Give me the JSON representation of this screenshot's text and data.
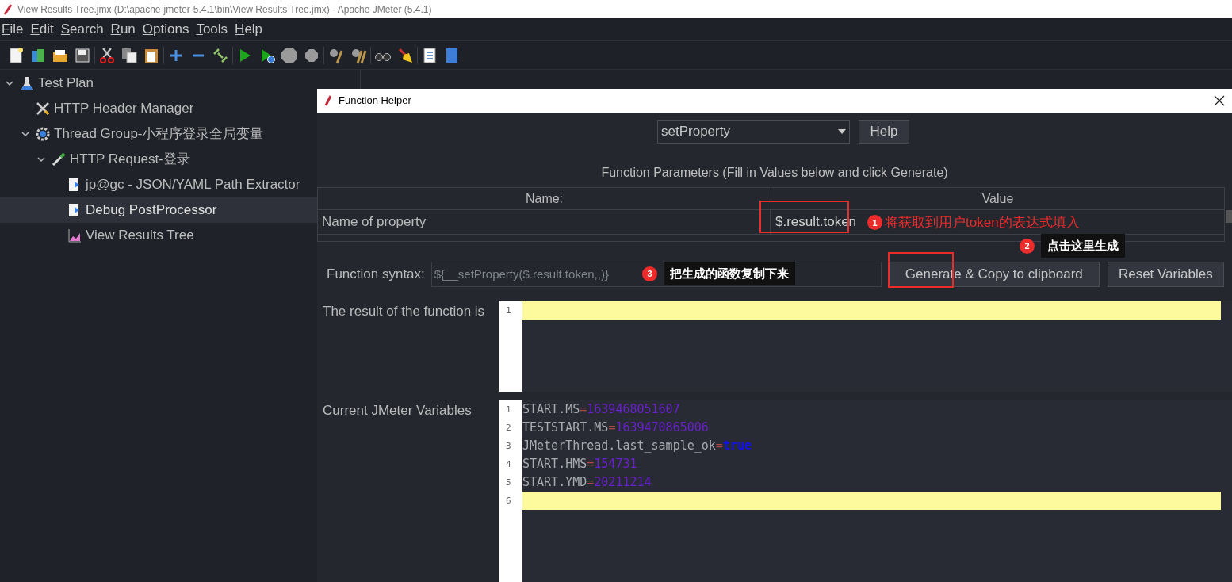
{
  "window": {
    "title": "View Results Tree.jmx (D:\\apache-jmeter-5.4.1\\bin\\View Results Tree.jmx) - Apache JMeter (5.4.1)"
  },
  "menu": [
    {
      "label": "File"
    },
    {
      "label": "Edit"
    },
    {
      "label": "Search"
    },
    {
      "label": "Run"
    },
    {
      "label": "Options"
    },
    {
      "label": "Tools"
    },
    {
      "label": "Help"
    }
  ],
  "tree": [
    {
      "label": "Test Plan",
      "kind": "plan",
      "expanded": true,
      "selected": false,
      "children": [
        {
          "label": "HTTP Header Manager",
          "kind": "config",
          "selected": false
        },
        {
          "label": "Thread Group-小程序登录全局变量",
          "kind": "threads",
          "expanded": true,
          "selected": false,
          "children": [
            {
              "label": "HTTP Request-登录",
              "kind": "sampler",
              "expanded": true,
              "selected": false,
              "children": [
                {
                  "label": "jp@gc - JSON/YAML Path Extractor",
                  "kind": "post",
                  "selected": false
                },
                {
                  "label": "Debug PostProcessor",
                  "kind": "post",
                  "selected": true
                },
                {
                  "label": "View Results Tree",
                  "kind": "listener",
                  "selected": false
                }
              ]
            }
          ]
        }
      ]
    }
  ],
  "dialog": {
    "title": "Function Helper",
    "function_select": {
      "value": "setProperty"
    },
    "help_button": "Help",
    "params_title": "Function Parameters (Fill in Values below and click Generate)",
    "table": {
      "columns": [
        "Name:",
        "Value"
      ],
      "rows": [
        {
          "name": "Name of property",
          "value": "$.result.token"
        }
      ]
    },
    "syntax_label": "Function syntax:",
    "syntax_field": {
      "value": "${__setProperty($.result.token,,)}",
      "disabled": true
    },
    "buttons": [
      "Generate & Copy to clipboard",
      "Reset Variables"
    ],
    "result_label": "The result of the function is",
    "result_editor": {
      "lines": [
        {
          "number": "1",
          "current": true
        }
      ]
    },
    "variables_label": "Current JMeter Variables",
    "variables_editor": {
      "lines": [
        {
          "number": "1",
          "current": false,
          "parts": [
            {
              "text": "START.MS",
              "kind": "key"
            },
            {
              "text": "=",
              "kind": "operator"
            },
            {
              "text": "1639468051607",
              "kind": "number"
            }
          ]
        },
        {
          "number": "2",
          "current": false,
          "parts": [
            {
              "text": "TESTSTART.MS",
              "kind": "key"
            },
            {
              "text": "=",
              "kind": "operator"
            },
            {
              "text": "1639470865006",
              "kind": "number"
            }
          ]
        },
        {
          "number": "3",
          "current": false,
          "parts": [
            {
              "text": "JMeterThread.last_sample_ok",
              "kind": "key"
            },
            {
              "text": "=",
              "kind": "operator"
            },
            {
              "text": "true",
              "kind": "boolean"
            }
          ]
        },
        {
          "number": "4",
          "current": false,
          "parts": [
            {
              "text": "START.HMS",
              "kind": "key"
            },
            {
              "text": "=",
              "kind": "operator"
            },
            {
              "text": "154731",
              "kind": "number"
            }
          ]
        },
        {
          "number": "5",
          "current": false,
          "parts": [
            {
              "text": "START.YMD",
              "kind": "key"
            },
            {
              "text": "=",
              "kind": "operator"
            },
            {
              "text": "20211214",
              "kind": "number"
            }
          ]
        },
        {
          "number": "6",
          "current": true
        }
      ]
    }
  },
  "annotations": [
    {
      "number": "1",
      "text": "将获取到用户token的表达式填入",
      "kind": "inline"
    },
    {
      "number": "2",
      "text": "点击这里生成",
      "kind": "tooltip"
    },
    {
      "number": "3",
      "text": "把生成的函数复制下来",
      "kind": "tooltip"
    }
  ]
}
